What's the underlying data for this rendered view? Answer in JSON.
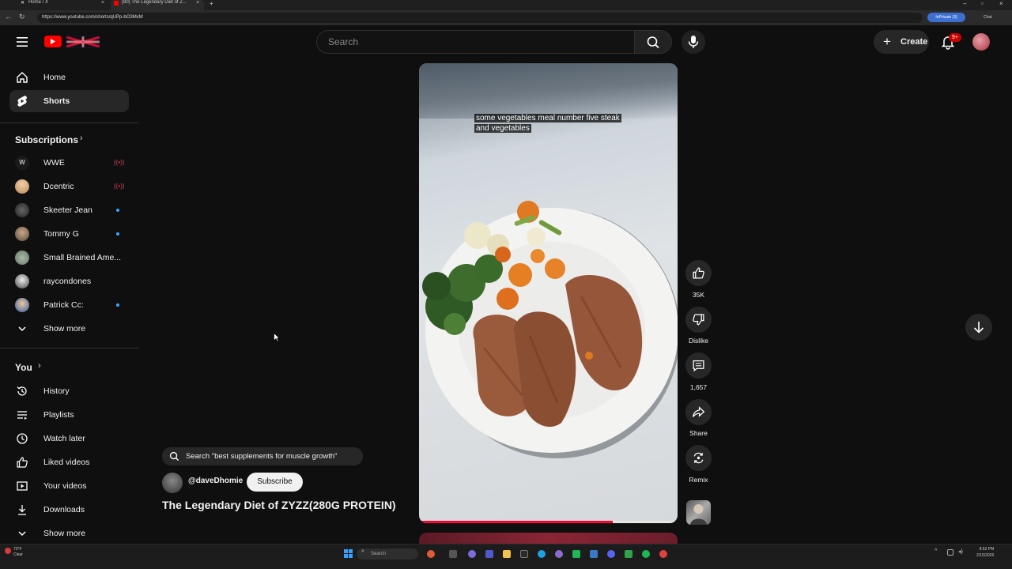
{
  "browser": {
    "tabs": [
      {
        "title": "Home / X"
      },
      {
        "title": "(80) The Legendary Diet of Z..."
      }
    ],
    "url": "https://www.youtube.com/shorts/qUPp-bO3MxM",
    "inprivate_label": "InPrivate (3)",
    "chat_label": "Chat"
  },
  "header": {
    "search_placeholder": "Search",
    "create_label": "Create",
    "notification_count": "9+"
  },
  "sidebar": {
    "main_items": [
      {
        "label": "Home",
        "icon": "home-icon"
      },
      {
        "label": "Shorts",
        "icon": "shorts-icon",
        "active": true
      }
    ],
    "subscriptions_title": "Subscriptions",
    "subscriptions": [
      {
        "label": "WWE",
        "status": "live",
        "color": "#1a1a1a"
      },
      {
        "label": "Dcentric",
        "status": "live",
        "color": "#d9b28a"
      },
      {
        "label": "Skeeter Jean",
        "status": "new",
        "color": "#3b3b3b"
      },
      {
        "label": "Tommy G",
        "status": "new",
        "color": "#7b6a5c"
      },
      {
        "label": "Small Brained Ame...",
        "status": "none",
        "color": "#8a9a8a"
      },
      {
        "label": "raycondones",
        "status": "none",
        "color": "#4a4a4a"
      },
      {
        "label": "Patrick Cc:",
        "status": "new",
        "color": "#2d5aa8"
      }
    ],
    "subs_show_more": "Show more",
    "you_title": "You",
    "you_items": [
      {
        "label": "History",
        "icon": "history-icon"
      },
      {
        "label": "Playlists",
        "icon": "playlists-icon"
      },
      {
        "label": "Watch later",
        "icon": "watch-later-icon"
      },
      {
        "label": "Liked videos",
        "icon": "liked-videos-icon"
      },
      {
        "label": "Your videos",
        "icon": "your-videos-icon"
      },
      {
        "label": "Downloads",
        "icon": "downloads-icon"
      }
    ],
    "you_show_more": "Show more"
  },
  "short": {
    "caption_line1": "some vegetables meal number five steak",
    "caption_line2": "and vegetables",
    "progress_fraction": 0.75,
    "title": "The Legendary Diet of ZYZZ(280G PROTEIN)",
    "channel": "@daveDhomie",
    "subscribe_label": "Subscribe",
    "search_suggestion": "Search \"best supplements for muscle growth\""
  },
  "actions": {
    "like_count": "35K",
    "dislike_label": "Dislike",
    "comment_count": "1,657",
    "share_label": "Share",
    "remix_label": "Remix"
  },
  "taskbar": {
    "search_label": "Search",
    "weather_temp": "72°F",
    "weather_desc": "Clear",
    "time": "8:52 PM",
    "date": "2/15/2026"
  }
}
